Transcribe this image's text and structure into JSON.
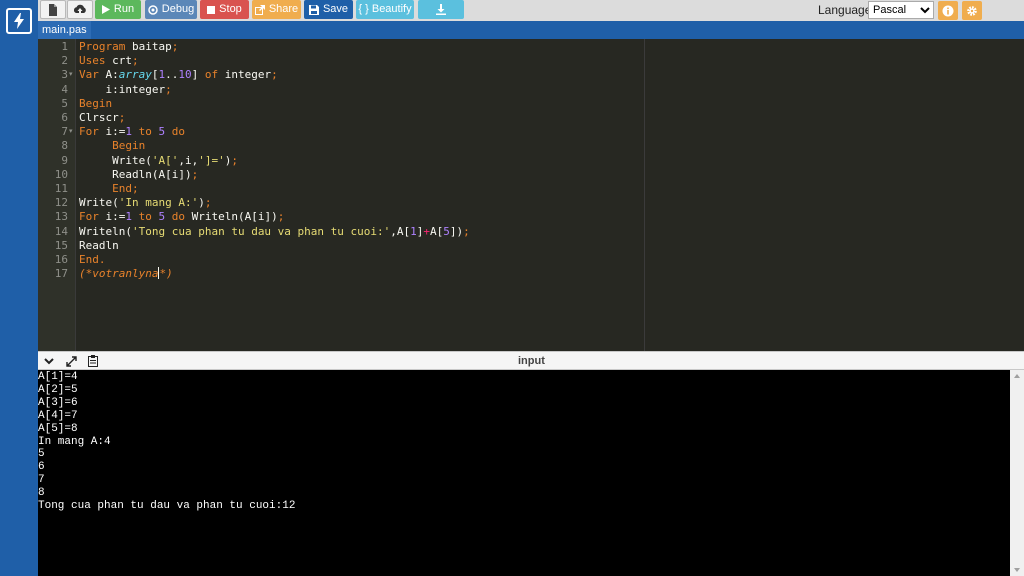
{
  "toolbar": {
    "run_label": "Run",
    "debug_label": "Debug",
    "stop_label": "Stop",
    "share_label": "Share",
    "save_label": "Save",
    "beautify_label": "{ } Beautify",
    "language_label": "Language",
    "language_value": "Pascal",
    "icons": {
      "file": "file-icon",
      "upload": "upload-icon",
      "run": "play-icon",
      "debug": "debug-icon",
      "stop": "stop-icon",
      "share": "share-icon",
      "save": "save-icon",
      "download": "download-icon",
      "info": "info-icon",
      "settings": "gear-icon"
    }
  },
  "tab": {
    "label": "main.pas"
  },
  "editor": {
    "line_numbers": [
      "1",
      "2",
      "3",
      "4",
      "5",
      "6",
      "7",
      "8",
      "9",
      "10",
      "11",
      "12",
      "13",
      "14",
      "15",
      "16",
      "17"
    ],
    "lines": [
      [
        [
          "kw",
          "Program"
        ],
        [
          "id",
          " baitap"
        ],
        [
          "kw",
          ";"
        ]
      ],
      [
        [
          "kw",
          "Uses"
        ],
        [
          "id",
          " crt"
        ],
        [
          "kw",
          ";"
        ]
      ],
      [
        [
          "kw",
          "Var"
        ],
        [
          "id",
          " A:"
        ],
        [
          "ty",
          "array"
        ],
        [
          "id",
          "["
        ],
        [
          "nm",
          "1"
        ],
        [
          "id",
          ".."
        ],
        [
          "nm",
          "10"
        ],
        [
          "id",
          "] "
        ],
        [
          "kw",
          "of"
        ],
        [
          "id",
          " integer"
        ],
        [
          "kw",
          ";"
        ]
      ],
      [
        [
          "id",
          "    i:integer"
        ],
        [
          "kw",
          ";"
        ]
      ],
      [
        [
          "kw",
          "Begin"
        ]
      ],
      [
        [
          "id",
          "Clrscr"
        ],
        [
          "kw",
          ";"
        ]
      ],
      [
        [
          "kw",
          "For"
        ],
        [
          "id",
          " i:="
        ],
        [
          "nm",
          "1"
        ],
        [
          "id",
          " "
        ],
        [
          "kw",
          "to"
        ],
        [
          "id",
          " "
        ],
        [
          "nm",
          "5"
        ],
        [
          "id",
          " "
        ],
        [
          "kw",
          "do"
        ]
      ],
      [
        [
          "id",
          "     "
        ],
        [
          "kw",
          "Begin"
        ]
      ],
      [
        [
          "id",
          "     Write("
        ],
        [
          "st",
          "'A['"
        ],
        [
          "id",
          ",i,"
        ],
        [
          "st",
          "']='"
        ],
        [
          "id",
          ")"
        ],
        [
          "kw",
          ";"
        ]
      ],
      [
        [
          "id",
          "     Readln(A[i])"
        ],
        [
          "kw",
          ";"
        ]
      ],
      [
        [
          "id",
          "     "
        ],
        [
          "kw",
          "End;"
        ]
      ],
      [
        [
          "id",
          "Write("
        ],
        [
          "st",
          "'In mang A:'"
        ],
        [
          "id",
          ")"
        ],
        [
          "kw",
          ";"
        ]
      ],
      [
        [
          "kw",
          "For"
        ],
        [
          "id",
          " i:="
        ],
        [
          "nm",
          "1"
        ],
        [
          "id",
          " "
        ],
        [
          "kw",
          "to"
        ],
        [
          "id",
          " "
        ],
        [
          "nm",
          "5"
        ],
        [
          "id",
          " "
        ],
        [
          "kw",
          "do"
        ],
        [
          "id",
          " Writeln(A[i])"
        ],
        [
          "kw",
          ";"
        ]
      ],
      [
        [
          "id",
          "Writeln("
        ],
        [
          "st",
          "'Tong cua phan tu dau va phan tu cuoi:'"
        ],
        [
          "id",
          ",A["
        ],
        [
          "nm",
          "1"
        ],
        [
          "id",
          "]"
        ],
        [
          "op",
          "+"
        ],
        [
          "id",
          "A["
        ],
        [
          "nm",
          "5"
        ],
        [
          "id",
          "])"
        ],
        [
          "kw",
          ";"
        ]
      ],
      [
        [
          "id",
          "Readln"
        ]
      ],
      [
        [
          "kw",
          "End."
        ]
      ],
      [
        [
          "cm",
          "(*votranlyna"
        ],
        [
          "cursor",
          ""
        ],
        [
          "cm",
          "*)"
        ]
      ]
    ],
    "fold_lines": [
      3,
      7
    ]
  },
  "divider": {
    "title": "input"
  },
  "console": {
    "lines": [
      "A[1]=4",
      "A[2]=5",
      "A[3]=6",
      "A[4]=7",
      "A[5]=8",
      "In mang A:4",
      "5",
      "6",
      "7",
      "8",
      "Tong cua phan tu dau va phan tu cuoi:12"
    ]
  },
  "colors": {
    "accent": "#1f5fa8",
    "run": "#5cb85c",
    "debug": "#5b87b8",
    "stop": "#d9534f",
    "share": "#f0ad4e",
    "beautify": "#5bc0de",
    "editor_bg": "#272822",
    "keyword": "#e8822b"
  }
}
